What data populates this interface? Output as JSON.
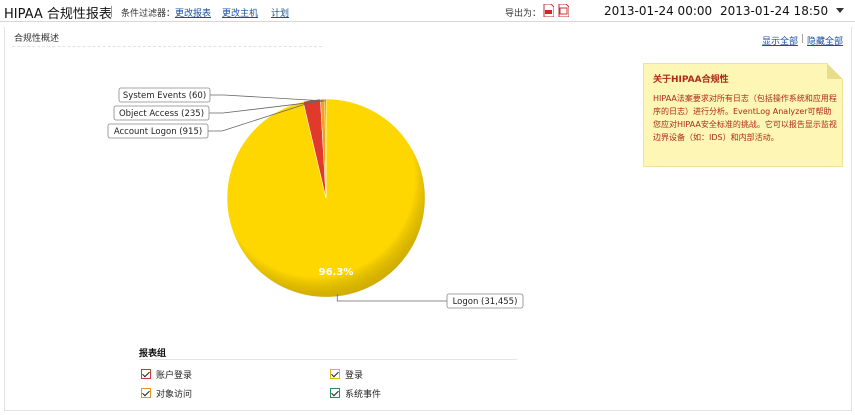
{
  "header": {
    "title": "HIPAA 合规性报表",
    "filter_label": "条件过滤器：",
    "links": [
      "更改报表",
      "更改主机",
      "计划"
    ],
    "export_label": "导出为：",
    "date_start": "2013-01-24 00:00",
    "date_end": "2013-01-24 18:50"
  },
  "section": {
    "title": "合规性概述",
    "show_all": "显示全部",
    "separator": "|",
    "hide_all": "隐藏全部"
  },
  "note": {
    "title": "关于HIPAA合规性",
    "body": "HIPAA法案要求对所有日志（包括操作系统和应用程序的日志）进行分析。EventLog Analyzer可帮助您应对HIPAA安全标准的挑战。它可以报告显示监视边界设备（如：IDS）和内部活动。"
  },
  "chart_data": {
    "type": "pie",
    "slices": [
      {
        "label": "Logon (31,455)",
        "name": "Logon",
        "value": 31455,
        "color": "#ffd700"
      },
      {
        "label": "Account Logon (915)",
        "name": "Account Logon",
        "value": 915,
        "color": "#e03a2c"
      },
      {
        "label": "Object Access (235)",
        "name": "Object Access",
        "value": 235,
        "color": "#f0a020"
      },
      {
        "label": "System Events (60)",
        "name": "System Events",
        "value": 60,
        "color": "#2e8b57"
      }
    ],
    "percent_label": "96.3%"
  },
  "report_group": {
    "title": "报表组",
    "items": [
      {
        "label": "账户登录",
        "color": "#d03a2c"
      },
      {
        "label": "登录",
        "color": "#e8b800"
      },
      {
        "label": "对象访问",
        "color": "#e89420"
      },
      {
        "label": "系统事件",
        "color": "#2e8b57"
      }
    ]
  }
}
